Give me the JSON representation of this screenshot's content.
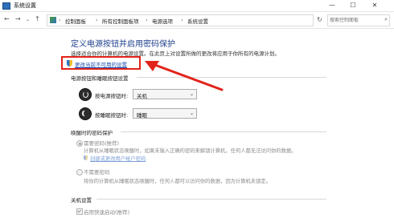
{
  "window": {
    "title": "系统设置",
    "minimize_glyph": "—",
    "maximize_glyph": "☐",
    "close_glyph": "✕"
  },
  "nav": {
    "back_glyph": "←",
    "forward_glyph": "→",
    "up_glyph": "↑",
    "dropdown_glyph": "⌄",
    "breadcrumb": [
      "控制面板",
      "所有控制面板项",
      "电源选项",
      "系统设置"
    ],
    "separator": "›",
    "refresh_glyph": "↻",
    "search_placeholder": "搜索控制面板",
    "search_glyph": "⌕"
  },
  "page": {
    "heading": "定义电源按钮并启用密码保护",
    "description": "选择适合你的计算机的电源设置。在此页上对设置所做的更改将应用于你所有的电源计划。",
    "change_link": "更改当前不可用的设置"
  },
  "power_buttons": {
    "section_title": "电源按钮和睡眠按钮设置",
    "power_label": "按电源按钮时:",
    "power_value": "关机",
    "sleep_label": "按睡眠按钮时:",
    "sleep_value": "睡眠",
    "dropdown_glyph": "⌄"
  },
  "wake_password": {
    "section_title": "唤醒时的密码保护",
    "require_label": "需要密码(推荐)",
    "require_desc": "计算机从睡眠状态唤醒时，如果未输入正确的密码来解锁计算机，任何人都无法访问你的数据。",
    "create_link": "创建或更改用户帐户密码",
    "no_require_label": "不需要密码",
    "no_require_desc": "将你的计算机从睡眠状态唤醒时，任何人都可以访问你的数据，因为计算机未锁定。"
  },
  "shutdown": {
    "section_title": "关机设置",
    "fast_startup_label": "启用快速启动(推荐)"
  },
  "colors": {
    "heading": "#1e3f8c",
    "link": "#1a4fb0",
    "highlight": "#e2231a"
  }
}
